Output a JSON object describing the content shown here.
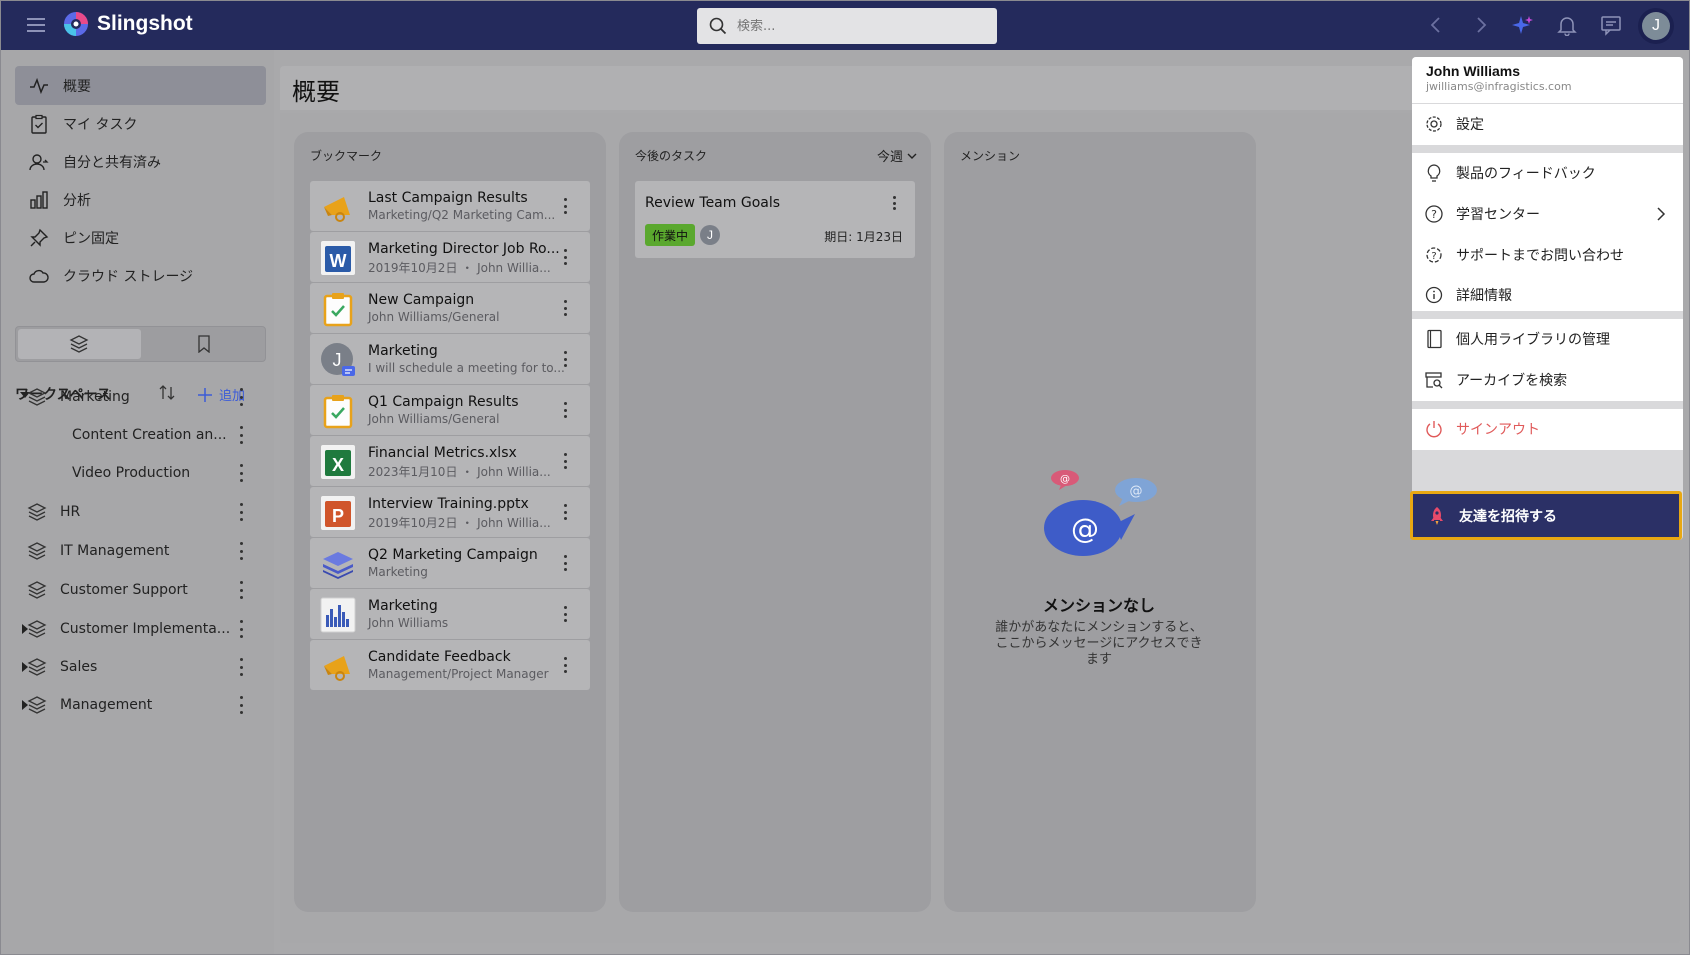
{
  "app": {
    "name": "Slingshot"
  },
  "search": {
    "placeholder": "検索..."
  },
  "user": {
    "initial": "J",
    "name": "John Williams",
    "email": "jwilliams@infragistics.com"
  },
  "nav": [
    {
      "label": "概要",
      "icon": "activity-icon"
    },
    {
      "label": "マイ タスク",
      "icon": "clipboard-icon"
    },
    {
      "label": "自分と共有済み",
      "icon": "user-share-icon"
    },
    {
      "label": "分析",
      "icon": "bar-chart-icon"
    },
    {
      "label": "ピン固定",
      "icon": "pin-icon"
    },
    {
      "label": "クラウド ストレージ",
      "icon": "cloud-icon"
    }
  ],
  "workspaces": {
    "title": "ワークスペース",
    "add_label": "追加",
    "items": [
      {
        "label": "Marketing",
        "expanded": true
      },
      {
        "label": "Content Creation an...",
        "sub": true
      },
      {
        "label": "Video Production",
        "sub": true
      },
      {
        "label": "HR"
      },
      {
        "label": "IT Management"
      },
      {
        "label": "Customer Support"
      },
      {
        "label": "Customer Implementa...",
        "collapsed": true
      },
      {
        "label": "Sales",
        "collapsed": true
      },
      {
        "label": "Management",
        "collapsed": true
      }
    ]
  },
  "page": {
    "title": "概要"
  },
  "bookmarks": {
    "title": "ブックマーク",
    "items": [
      {
        "title": "Last Campaign Results",
        "sub": "Marketing/Q2 Marketing Cam...",
        "icon": "megaphone-icon"
      },
      {
        "title": "Marketing Director Job Ro...",
        "sub": "2019年10月2日 ・ John Willia...",
        "icon": "word-doc-icon"
      },
      {
        "title": "New Campaign",
        "sub": "John Williams/General",
        "icon": "task-board-icon"
      },
      {
        "title": "Marketing",
        "sub": "I will schedule a meeting for to...",
        "icon": "chat-avatar-icon"
      },
      {
        "title": "Q1 Campaign Results",
        "sub": "John Williams/General",
        "icon": "task-board-icon"
      },
      {
        "title": "Financial Metrics.xlsx",
        "sub": "2023年1月10日 ・ John Willia...",
        "icon": "excel-icon"
      },
      {
        "title": "Interview Training.pptx",
        "sub": "2019年10月2日 ・ John Willia...",
        "icon": "powerpoint-icon"
      },
      {
        "title": "Q2 Marketing Campaign",
        "sub": "Marketing",
        "icon": "layers-icon"
      },
      {
        "title": "Marketing",
        "sub": "John Williams",
        "icon": "dashboard-chart-icon"
      },
      {
        "title": "Candidate Feedback",
        "sub": "Management/Project Manager",
        "icon": "megaphone-icon"
      }
    ]
  },
  "tasks": {
    "title": "今後のタスク",
    "filter": "今週",
    "items": [
      {
        "title": "Review Team Goals",
        "status": "作業中",
        "assignee": "J",
        "due": "期日: 1月23日"
      }
    ]
  },
  "mentions": {
    "title": "メンション",
    "empty_title": "メンションなし",
    "empty_text": "誰かがあなたにメンションすると、ここからメッセージにアクセスできます"
  },
  "menu": {
    "settings": "設定",
    "feedback": "製品のフィードバック",
    "learning": "学習センター",
    "support": "サポートまでお問い合わせ",
    "about": "詳細情報",
    "library": "個人用ライブラリの管理",
    "archive": "アーカイブを検索",
    "signout": "サインアウト",
    "invite": "友達を招待する"
  },
  "colors": {
    "topbar": "#242a5c",
    "accent": "#3b5bd8",
    "signout": "#e05a5a",
    "invite_border": "#e8a813",
    "status_green": "#5aa82e"
  }
}
